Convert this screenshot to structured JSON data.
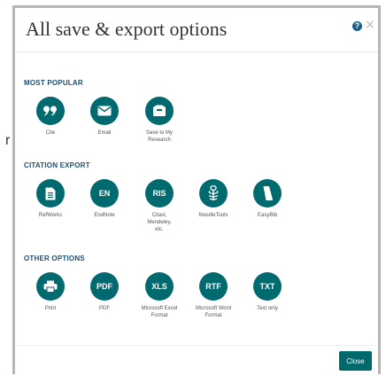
{
  "background": {
    "partial_text": "r"
  },
  "modal": {
    "title": "All save & export options",
    "help_icon": "?",
    "close_icon": "×"
  },
  "sections": [
    {
      "title": "MOST POPULAR",
      "items": [
        {
          "label": "Cite",
          "icon": "quote-icon"
        },
        {
          "label": "Email",
          "icon": "envelope-icon"
        },
        {
          "label": "Save to My Research",
          "icon": "folder-icon"
        }
      ]
    },
    {
      "title": "CITATION EXPORT",
      "items": [
        {
          "label": "RefWorks",
          "icon": "document-icon"
        },
        {
          "label": "EndNote",
          "icon": "endnote-icon",
          "badge": "EN"
        },
        {
          "label": "Citavi, Mendeley, etc.",
          "icon": "ris-icon",
          "badge": "RIS"
        },
        {
          "label": "NoodleTools",
          "icon": "noodletools-icon"
        },
        {
          "label": "EasyBib",
          "icon": "easybib-icon"
        }
      ]
    },
    {
      "title": "OTHER OPTIONS",
      "items": [
        {
          "label": "Print",
          "icon": "printer-icon"
        },
        {
          "label": "PDF",
          "icon": "pdf-icon",
          "badge": "PDF"
        },
        {
          "label": "Microsoft Excel Format",
          "icon": "xls-icon",
          "badge": "XLS"
        },
        {
          "label": "Microsoft Word Format",
          "icon": "rtf-icon",
          "badge": "RTF"
        },
        {
          "label": "Text only",
          "icon": "txt-icon",
          "badge": "TXT"
        }
      ]
    }
  ],
  "footer": {
    "close_label": "Close"
  },
  "colors": {
    "accent": "#006a6e",
    "section_title": "#1c4f73",
    "help": "#1c5f86"
  }
}
